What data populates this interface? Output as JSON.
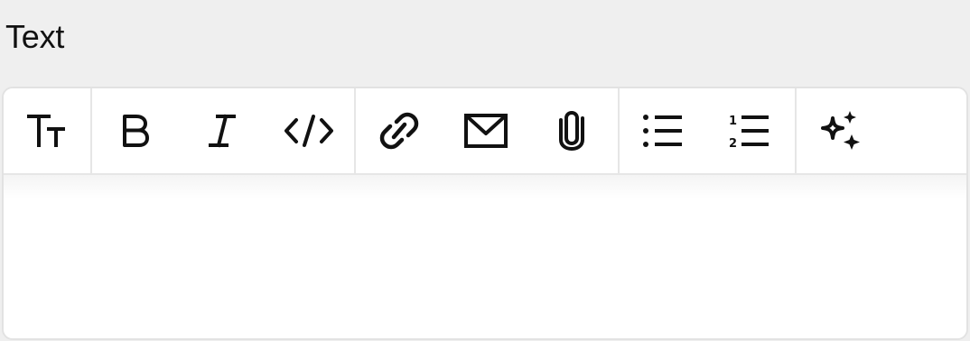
{
  "field": {
    "label": "Text"
  },
  "toolbar": {
    "groups": [
      {
        "buttons": [
          {
            "icon": "text-size-icon",
            "name": "text-size-button"
          }
        ]
      },
      {
        "buttons": [
          {
            "icon": "bold-icon",
            "name": "bold-button"
          },
          {
            "icon": "italic-icon",
            "name": "italic-button"
          },
          {
            "icon": "code-icon",
            "name": "code-button"
          }
        ]
      },
      {
        "buttons": [
          {
            "icon": "link-icon",
            "name": "link-button"
          },
          {
            "icon": "mail-icon",
            "name": "email-button"
          },
          {
            "icon": "paperclip-icon",
            "name": "attachment-button"
          }
        ]
      },
      {
        "buttons": [
          {
            "icon": "bulleted-list-icon",
            "name": "bulleted-list-button"
          },
          {
            "icon": "numbered-list-icon",
            "name": "numbered-list-button"
          }
        ]
      },
      {
        "buttons": [
          {
            "icon": "sparkles-icon",
            "name": "ai-assist-button"
          }
        ]
      }
    ]
  },
  "editor": {
    "value": ""
  },
  "colors": {
    "page_background": "#efefef",
    "editor_background": "#ffffff",
    "border": "#e2e2e2",
    "icon": "#111111"
  }
}
